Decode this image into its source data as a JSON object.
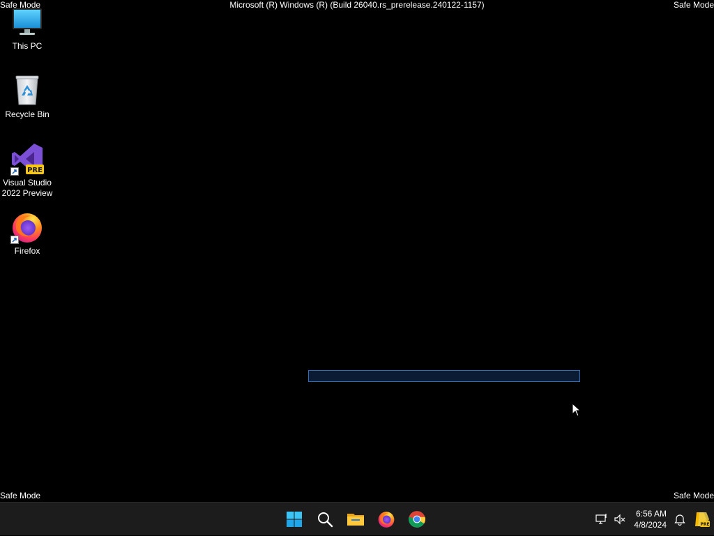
{
  "watermark": {
    "top_left": "Safe Mode",
    "top_right": "Safe Mode",
    "bottom_left": "Safe Mode",
    "bottom_right": "Safe Mode",
    "title": "Microsoft (R) Windows (R) (Build 26040.rs_prerelease.240122-1157)"
  },
  "desktop_icons": [
    {
      "name": "this-pc",
      "label": "This PC",
      "icon": "monitor-icon"
    },
    {
      "name": "recycle-bin",
      "label": "Recycle Bin",
      "icon": "recycle-bin-icon"
    },
    {
      "name": "visual-studio",
      "label": "Visual Studio 2022 Preview",
      "icon": "visual-studio-icon",
      "badge": "PRE"
    },
    {
      "name": "firefox",
      "label": "Firefox",
      "icon": "firefox-icon"
    }
  ],
  "taskbar": {
    "apps": [
      {
        "name": "start",
        "icon": "windows-logo-icon"
      },
      {
        "name": "search",
        "icon": "search-icon"
      },
      {
        "name": "file-explorer",
        "icon": "folder-icon"
      },
      {
        "name": "firefox",
        "icon": "firefox-icon"
      },
      {
        "name": "chrome",
        "icon": "chrome-icon"
      }
    ],
    "tray": {
      "time": "6:56 AM",
      "date": "4/8/2024",
      "icons": [
        "network-icon",
        "volume-muted-icon",
        "notification-bell-icon",
        "copilot-pre-icon"
      ]
    }
  },
  "colors": {
    "desktop_bg": "#000000",
    "taskbar_bg": "#1c1c1c",
    "progress_border": "#2f6dbb"
  }
}
